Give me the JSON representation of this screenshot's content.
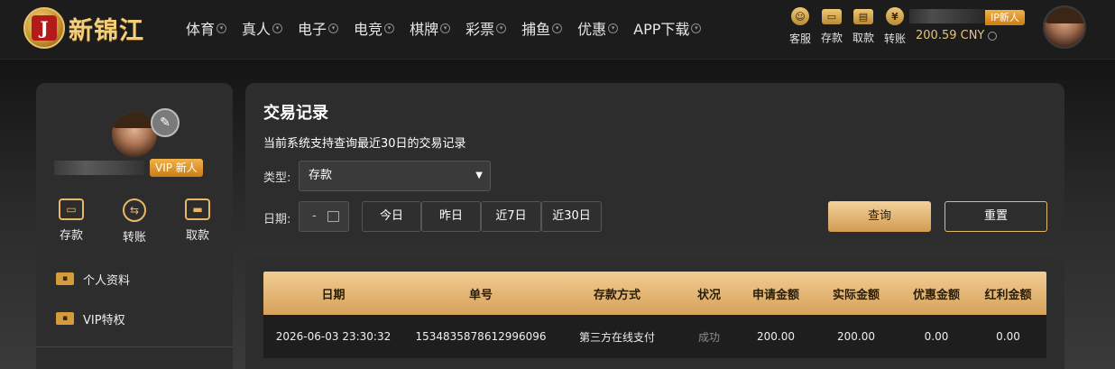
{
  "brand": {
    "name": "新锦江",
    "mark": "J"
  },
  "nav": [
    {
      "label": "体育"
    },
    {
      "label": "真人"
    },
    {
      "label": "电子"
    },
    {
      "label": "电竞"
    },
    {
      "label": "棋牌"
    },
    {
      "label": "彩票"
    },
    {
      "label": "捕鱼"
    },
    {
      "label": "优惠"
    },
    {
      "label": "APP下载"
    }
  ],
  "header_tools": [
    {
      "label": "客服",
      "icon": "customer-service-icon"
    },
    {
      "label": "存款",
      "icon": "wallet-icon"
    },
    {
      "label": "取款",
      "icon": "withdraw-icon"
    },
    {
      "label": "转账",
      "icon": "transfer-icon"
    }
  ],
  "account": {
    "vip_badge": "IP新人",
    "balance": "200.59 CNY"
  },
  "sidebar": {
    "vip_badge": "VIP 新人",
    "actions": [
      {
        "label": "存款",
        "icon": "wallet-icon"
      },
      {
        "label": "转账",
        "icon": "transfer-icon"
      },
      {
        "label": "取款",
        "icon": "card-icon"
      }
    ],
    "menu": [
      {
        "label": "个人资料",
        "icon": "id-card-icon"
      },
      {
        "label": "VIP特权",
        "icon": "vip-card-icon"
      }
    ]
  },
  "records": {
    "title": "交易记录",
    "subtitle": "当前系统支持查询最近30日的交易记录",
    "type_label": "类型:",
    "type_value": "存款",
    "date_label": "日期:",
    "date_value": "-",
    "quick_ranges": [
      "今日",
      "昨日",
      "近7日",
      "近30日"
    ],
    "query_label": "查询",
    "reset_label": "重置"
  },
  "table": {
    "columns": [
      "日期",
      "单号",
      "存款方式",
      "状况",
      "申请金额",
      "实际金额",
      "优惠金额",
      "红利金额"
    ],
    "rows": [
      [
        "2026-06-03 23:30:32",
        "1534835878612996096",
        "第三方在线支付",
        "成功",
        "200.00",
        "200.00",
        "0.00",
        "0.00"
      ]
    ]
  }
}
